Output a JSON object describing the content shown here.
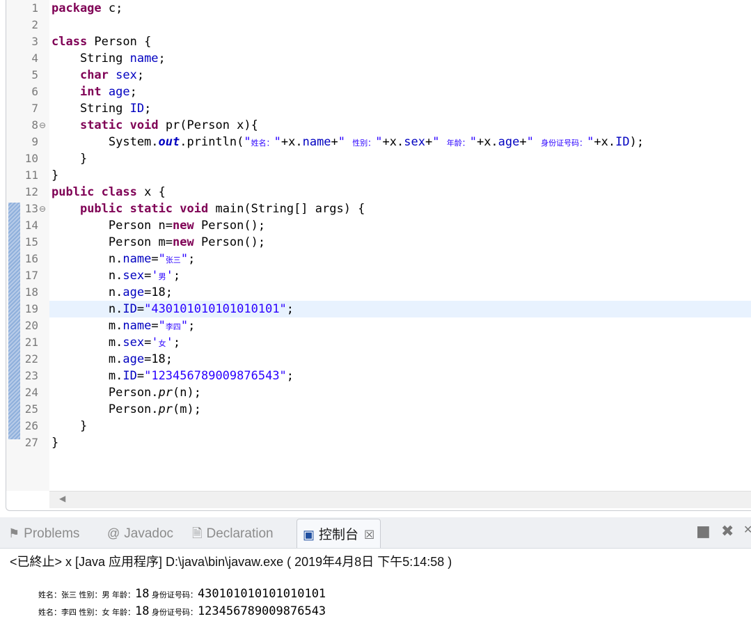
{
  "editor": {
    "lines": [
      {
        "n": "1",
        "fold": "",
        "segs": [
          {
            "c": "kw",
            "t": "package"
          },
          {
            "c": "",
            "t": " c;"
          }
        ]
      },
      {
        "n": "2",
        "fold": "",
        "segs": []
      },
      {
        "n": "3",
        "fold": "",
        "segs": [
          {
            "c": "kw",
            "t": "class"
          },
          {
            "c": "",
            "t": " Person {"
          }
        ]
      },
      {
        "n": "4",
        "fold": "",
        "segs": [
          {
            "c": "",
            "t": "    String "
          },
          {
            "c": "fld",
            "t": "name"
          },
          {
            "c": "",
            "t": ";"
          }
        ]
      },
      {
        "n": "5",
        "fold": "",
        "segs": [
          {
            "c": "",
            "t": "    "
          },
          {
            "c": "kw",
            "t": "char"
          },
          {
            "c": "",
            "t": " "
          },
          {
            "c": "fld",
            "t": "sex"
          },
          {
            "c": "",
            "t": ";"
          }
        ]
      },
      {
        "n": "6",
        "fold": "",
        "segs": [
          {
            "c": "",
            "t": "    "
          },
          {
            "c": "kw",
            "t": "int"
          },
          {
            "c": "",
            "t": " "
          },
          {
            "c": "fld",
            "t": "age"
          },
          {
            "c": "",
            "t": ";"
          }
        ]
      },
      {
        "n": "7",
        "fold": "",
        "segs": [
          {
            "c": "",
            "t": "    String "
          },
          {
            "c": "fld",
            "t": "ID"
          },
          {
            "c": "",
            "t": ";"
          }
        ]
      },
      {
        "n": "8",
        "fold": "⊖",
        "segs": [
          {
            "c": "",
            "t": "    "
          },
          {
            "c": "kw",
            "t": "static"
          },
          {
            "c": "",
            "t": " "
          },
          {
            "c": "kw",
            "t": "void"
          },
          {
            "c": "",
            "t": " pr(Person x){"
          }
        ]
      },
      {
        "n": "9",
        "fold": "",
        "segs": [
          {
            "c": "",
            "t": "        System."
          },
          {
            "c": "fld ital bold",
            "t": "out"
          },
          {
            "c": "",
            "t": ".println("
          },
          {
            "c": "str",
            "t": "\""
          },
          {
            "c": "str cjk",
            "t": "姓名："
          },
          {
            "c": "str",
            "t": "\""
          },
          {
            "c": "",
            "t": "+x."
          },
          {
            "c": "fld",
            "t": "name"
          },
          {
            "c": "",
            "t": "+"
          },
          {
            "c": "str",
            "t": "\" "
          },
          {
            "c": "str cjk",
            "t": "性别："
          },
          {
            "c": "str",
            "t": "\""
          },
          {
            "c": "",
            "t": "+x."
          },
          {
            "c": "fld",
            "t": "sex"
          },
          {
            "c": "",
            "t": "+"
          },
          {
            "c": "str",
            "t": "\" "
          },
          {
            "c": "str cjk",
            "t": "年龄："
          },
          {
            "c": "str",
            "t": "\""
          },
          {
            "c": "",
            "t": "+x."
          },
          {
            "c": "fld",
            "t": "age"
          },
          {
            "c": "",
            "t": "+"
          },
          {
            "c": "str",
            "t": "\" "
          },
          {
            "c": "str cjk",
            "t": "身份证号码："
          },
          {
            "c": "str",
            "t": "\""
          },
          {
            "c": "",
            "t": "+x."
          },
          {
            "c": "fld",
            "t": "ID"
          },
          {
            "c": "",
            "t": ");"
          }
        ]
      },
      {
        "n": "10",
        "fold": "",
        "segs": [
          {
            "c": "",
            "t": "    }"
          }
        ]
      },
      {
        "n": "11",
        "fold": "",
        "segs": [
          {
            "c": "",
            "t": "}"
          }
        ]
      },
      {
        "n": "12",
        "fold": "",
        "segs": [
          {
            "c": "kw",
            "t": "public"
          },
          {
            "c": "",
            "t": " "
          },
          {
            "c": "kw",
            "t": "class"
          },
          {
            "c": "",
            "t": " x {"
          }
        ]
      },
      {
        "n": "13",
        "fold": "⊖",
        "segs": [
          {
            "c": "",
            "t": "    "
          },
          {
            "c": "kw",
            "t": "public"
          },
          {
            "c": "",
            "t": " "
          },
          {
            "c": "kw",
            "t": "static"
          },
          {
            "c": "",
            "t": " "
          },
          {
            "c": "kw",
            "t": "void"
          },
          {
            "c": "",
            "t": " main(String[] args) {"
          }
        ]
      },
      {
        "n": "14",
        "fold": "",
        "segs": [
          {
            "c": "",
            "t": "        Person n="
          },
          {
            "c": "kw",
            "t": "new"
          },
          {
            "c": "",
            "t": " Person();"
          }
        ]
      },
      {
        "n": "15",
        "fold": "",
        "segs": [
          {
            "c": "",
            "t": "        Person m="
          },
          {
            "c": "kw",
            "t": "new"
          },
          {
            "c": "",
            "t": " Person();"
          }
        ]
      },
      {
        "n": "16",
        "fold": "",
        "segs": [
          {
            "c": "",
            "t": "        n."
          },
          {
            "c": "fld",
            "t": "name"
          },
          {
            "c": "",
            "t": "="
          },
          {
            "c": "str",
            "t": "\""
          },
          {
            "c": "str cjk",
            "t": "张三"
          },
          {
            "c": "str",
            "t": "\""
          },
          {
            "c": "",
            "t": ";"
          }
        ]
      },
      {
        "n": "17",
        "fold": "",
        "segs": [
          {
            "c": "",
            "t": "        n."
          },
          {
            "c": "fld",
            "t": "sex"
          },
          {
            "c": "",
            "t": "="
          },
          {
            "c": "str",
            "t": "'"
          },
          {
            "c": "str cjk",
            "t": "男"
          },
          {
            "c": "str",
            "t": "'"
          },
          {
            "c": "",
            "t": ";"
          }
        ]
      },
      {
        "n": "18",
        "fold": "",
        "segs": [
          {
            "c": "",
            "t": "        n."
          },
          {
            "c": "fld",
            "t": "age"
          },
          {
            "c": "",
            "t": "=18;"
          }
        ]
      },
      {
        "n": "19",
        "fold": "",
        "current": true,
        "segs": [
          {
            "c": "",
            "t": "        n."
          },
          {
            "c": "fld",
            "t": "ID"
          },
          {
            "c": "",
            "t": "="
          },
          {
            "c": "str",
            "t": "\"430101010101010101\""
          },
          {
            "c": "",
            "t": ";"
          }
        ]
      },
      {
        "n": "20",
        "fold": "",
        "segs": [
          {
            "c": "",
            "t": "        m."
          },
          {
            "c": "fld",
            "t": "name"
          },
          {
            "c": "",
            "t": "="
          },
          {
            "c": "str",
            "t": "\""
          },
          {
            "c": "str cjk",
            "t": "李四"
          },
          {
            "c": "str",
            "t": "\""
          },
          {
            "c": "",
            "t": ";"
          }
        ]
      },
      {
        "n": "21",
        "fold": "",
        "segs": [
          {
            "c": "",
            "t": "        m."
          },
          {
            "c": "fld",
            "t": "sex"
          },
          {
            "c": "",
            "t": "="
          },
          {
            "c": "str",
            "t": "'"
          },
          {
            "c": "str cjk",
            "t": "女"
          },
          {
            "c": "str",
            "t": "'"
          },
          {
            "c": "",
            "t": ";"
          }
        ]
      },
      {
        "n": "22",
        "fold": "",
        "segs": [
          {
            "c": "",
            "t": "        m."
          },
          {
            "c": "fld",
            "t": "age"
          },
          {
            "c": "",
            "t": "=18;"
          }
        ]
      },
      {
        "n": "23",
        "fold": "",
        "segs": [
          {
            "c": "",
            "t": "        m."
          },
          {
            "c": "fld",
            "t": "ID"
          },
          {
            "c": "",
            "t": "="
          },
          {
            "c": "str",
            "t": "\"123456789009876543\""
          },
          {
            "c": "",
            "t": ";"
          }
        ]
      },
      {
        "n": "24",
        "fold": "",
        "segs": [
          {
            "c": "",
            "t": "        Person."
          },
          {
            "c": "ital",
            "t": "pr"
          },
          {
            "c": "",
            "t": "(n);"
          }
        ]
      },
      {
        "n": "25",
        "fold": "",
        "segs": [
          {
            "c": "",
            "t": "        Person."
          },
          {
            "c": "ital",
            "t": "pr"
          },
          {
            "c": "",
            "t": "(m);"
          }
        ]
      },
      {
        "n": "26",
        "fold": "",
        "segs": [
          {
            "c": "",
            "t": "    }"
          }
        ]
      },
      {
        "n": "27",
        "fold": "",
        "segs": [
          {
            "c": "",
            "t": "}"
          }
        ]
      }
    ]
  },
  "views": {
    "tabs": [
      {
        "label": "Problems",
        "icon": "problems-icon",
        "glyph": "⚑"
      },
      {
        "label": "Javadoc",
        "icon": "javadoc-icon",
        "glyph": "@"
      },
      {
        "label": "Declaration",
        "icon": "declaration-icon",
        "glyph": "🗎"
      },
      {
        "label": "控制台",
        "icon": "console-icon",
        "glyph": "▣",
        "close": "☒"
      }
    ],
    "status": "<已終止> x [Java 应用程序] D:\\java\\bin\\javaw.exe ( 2019年4月8日 下午5:14:58 )",
    "output": [
      {
        "name_label": "姓名：",
        "name": "张三",
        "sex_label": " 性别：",
        "sex": "男",
        "age_label": " 年龄：",
        "age": "18",
        "id_label": " 身份证号码：",
        "id": "430101010101010101"
      },
      {
        "name_label": "姓名：",
        "name": "李四",
        "sex_label": " 性别：",
        "sex": "女",
        "age_label": " 年龄：",
        "age": "18",
        "id_label": " 身份证号码：",
        "id": "123456789009876543"
      }
    ]
  },
  "colors": {
    "keyword": "#7f0055",
    "field": "#0000c0",
    "string": "#2a00ff",
    "current_line": "#e8f2fe"
  }
}
